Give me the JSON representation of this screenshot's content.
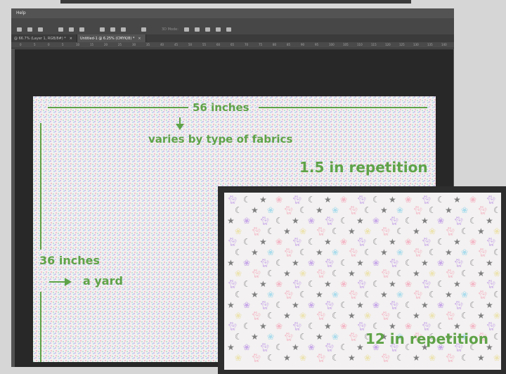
{
  "app": {
    "menu": {
      "help_label": "Help"
    },
    "options_bar": {
      "three_d_mode_label": "3D Mode:"
    },
    "tabs": [
      {
        "label": "@ 66.7% (Layer 1, RGB/8#) *",
        "close": "×"
      },
      {
        "label": "Untitled-1 @ 6.25% (CMYK/8) *",
        "close": "×"
      }
    ],
    "ruler_ticks": [
      "0",
      "5",
      "0",
      "5",
      "10",
      "15",
      "20",
      "25",
      "30",
      "35",
      "40",
      "45",
      "50",
      "55",
      "60",
      "65",
      "70",
      "75",
      "80",
      "85",
      "90",
      "95",
      "100",
      "105",
      "110",
      "115",
      "120",
      "125",
      "130",
      "135",
      "140",
      "145"
    ]
  },
  "annotations": {
    "width_label": "56 inches",
    "varies_label": "varies by type of fabrics",
    "repetition_small_label": "1.5 in repetition",
    "height_label": "36 inches",
    "yard_label": "a yard",
    "repetition_large_label": "12 in repetition"
  },
  "colors": {
    "annotation_green": "#5fa348",
    "cat_purple": "#c7a8e8",
    "cat_blue": "#a9dcec",
    "cat_pink": "#f3b7c6",
    "cat_yellow": "#ece3b0",
    "moon_grey": "#8a8a8a"
  },
  "pattern_motifs": [
    "cat-icon",
    "moon-icon",
    "star-icon",
    "paw-icon"
  ]
}
